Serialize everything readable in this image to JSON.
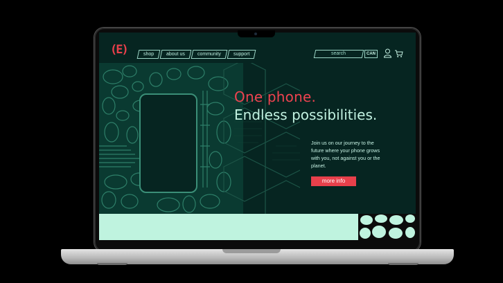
{
  "brand": {
    "logo_text": "(E)"
  },
  "nav": {
    "items": [
      {
        "label": "shop"
      },
      {
        "label": "about us"
      },
      {
        "label": "community"
      },
      {
        "label": "support"
      }
    ],
    "search_placeholder": "search",
    "language": "CAN",
    "user_icon": "user-icon",
    "cart_icon": "cart-icon"
  },
  "hero": {
    "headline_1": "One phone.",
    "headline_2": "Endless possibilities.",
    "body": "Join us on our journey to the future where your phone grows with you, not against you or the planet.",
    "cta_label": "more info"
  },
  "colors": {
    "background": "#062521",
    "accent_red": "#e8404b",
    "mint": "#bff3df",
    "pattern_green": "#2e7f69"
  }
}
